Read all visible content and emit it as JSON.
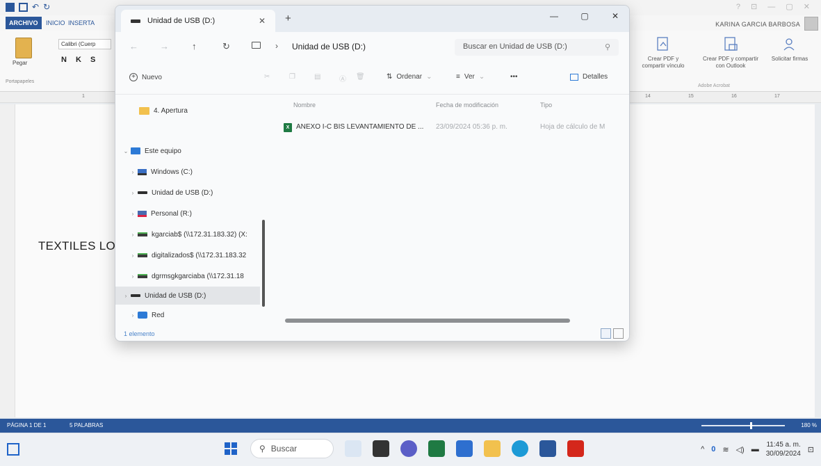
{
  "word": {
    "tabs": [
      "ARCHIVO",
      "INICIO",
      "INSERTA"
    ],
    "user": "KARINA GARCIA BARBOSA",
    "paste_label": "Pegar",
    "font_name": "Calibri (Cuerp",
    "format_buttons": "N K S",
    "clipboard_group": "Portapapeles",
    "acrobat": {
      "btn1": "Crear PDF y compartir vínculo",
      "btn2": "Crear PDF y compartir con Outlook",
      "btn3": "Solicitar firmas",
      "group": "Adobe Acrobat"
    },
    "ruler_numbers": [
      "1",
      "14",
      "15",
      "16",
      "17"
    ],
    "document_text": "TEXTILES LO",
    "status": {
      "page": "PÁGINA 1 DE 1",
      "words": "5 PALABRAS",
      "zoom": "180 %"
    }
  },
  "explorer": {
    "tab_title": "Unidad de USB (D:)",
    "address_path": "Unidad de USB (D:)",
    "search_placeholder": "Buscar en Unidad de USB (D:)",
    "commands": {
      "new": "Nuevo",
      "sort": "Ordenar",
      "view": "Ver",
      "more": "•••",
      "details": "Detalles"
    },
    "nav_items": [
      {
        "label": "4. Apertura",
        "icon": "folder-icon"
      },
      {
        "label": "Este equipo",
        "icon": "pc-icon"
      },
      {
        "label": "Windows (C:)",
        "icon": "windows-drive-icon"
      },
      {
        "label": "Unidad de USB (D:)",
        "icon": "usb-drive-icon"
      },
      {
        "label": "Personal (R:)",
        "icon": "personal-drive-icon"
      },
      {
        "label": "kgarciab$ (\\\\172.31.183.32) (X:",
        "icon": "network-drive-icon"
      },
      {
        "label": "digitalizados$ (\\\\172.31.183.32",
        "icon": "network-drive-icon"
      },
      {
        "label": "dgrmsgkgarciaba (\\\\172.31.18",
        "icon": "network-drive-icon"
      },
      {
        "label": "Unidad de USB (D:)",
        "icon": "usb-drive-icon"
      },
      {
        "label": "Red",
        "icon": "network-icon"
      }
    ],
    "columns": [
      "Nombre",
      "Fecha de modificación",
      "Tipo"
    ],
    "files": [
      {
        "name": "ANEXO I-C BIS LEVANTAMIENTO DE ...",
        "date": "23/09/2024 05:36 p. m.",
        "type": "Hoja de cálculo de M"
      }
    ],
    "status": "1 elemento"
  },
  "taskbar": {
    "search_label": "Buscar",
    "time": "11:45 a. m.",
    "date": "30/09/2024"
  },
  "colors": {
    "word_blue": "#2b579a",
    "explorer_bg": "#f9fafb",
    "excel_green": "#1f7a43"
  }
}
